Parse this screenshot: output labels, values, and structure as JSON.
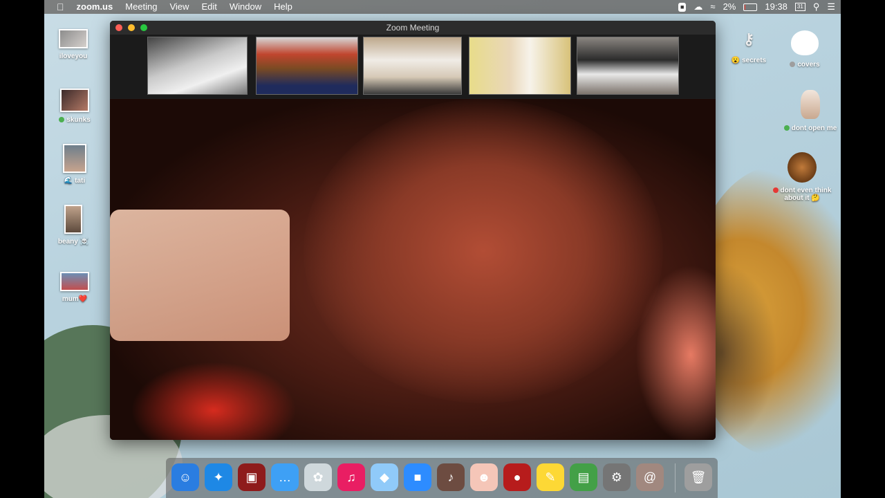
{
  "menubar": {
    "apple_icon": "apple-icon",
    "app_name": "zoom.us",
    "items": [
      "Meeting",
      "View",
      "Edit",
      "Window",
      "Help"
    ],
    "battery_percent": "2%",
    "battery_level": 0.02,
    "clock": "19:38"
  },
  "window": {
    "title": "Zoom Meeting",
    "traffic_colors": [
      "#ff5f57",
      "#febc2e",
      "#28c840"
    ]
  },
  "participants_count_visible": 5,
  "desktop_left": [
    {
      "label": "iloveyou"
    },
    {
      "label": "skunks",
      "tag": "#4caf50"
    },
    {
      "label": "tati",
      "emoji": "🌊"
    },
    {
      "label": "beany",
      "emoji": "☠️"
    },
    {
      "label": "mum",
      "emoji": "❤️"
    }
  ],
  "desktop_right": [
    {
      "label": "secrets",
      "emoji": "😮"
    },
    {
      "label": "covers",
      "tag": "#9e9e9e"
    },
    {
      "label": "dont open me",
      "tag": "#4caf50"
    },
    {
      "label": "dont even think about it",
      "tag": "#e53935",
      "emoji": "🤔"
    }
  ],
  "dock": [
    {
      "name": "finder-icon",
      "glyph": "☺",
      "color": "#2a7de1"
    },
    {
      "name": "safari-icon",
      "glyph": "✦",
      "color": "#1e88e5"
    },
    {
      "name": "photo-booth-icon",
      "glyph": "▣",
      "color": "#8e1b1b"
    },
    {
      "name": "messages-icon",
      "glyph": "…",
      "color": "#3ea0f5"
    },
    {
      "name": "skype-icon",
      "glyph": "✿",
      "color": "#cfd8dc"
    },
    {
      "name": "itunes-icon",
      "glyph": "♫",
      "color": "#e91e63"
    },
    {
      "name": "seal-icon",
      "glyph": "◆",
      "color": "#90caf9"
    },
    {
      "name": "zoom-icon",
      "glyph": "■",
      "color": "#2d8cff"
    },
    {
      "name": "garageband-icon",
      "glyph": "♪",
      "color": "#6d4c41"
    },
    {
      "name": "face-icon",
      "glyph": "☻",
      "color": "#f5c6b8"
    },
    {
      "name": "photo-booth-alt-icon",
      "glyph": "●",
      "color": "#b71c1c"
    },
    {
      "name": "stickies-icon",
      "glyph": "✎",
      "color": "#fdd835"
    },
    {
      "name": "preview-icon",
      "glyph": "▤",
      "color": "#43a047"
    },
    {
      "name": "system-preferences-icon",
      "glyph": "⚙",
      "color": "#757575"
    },
    {
      "name": "contacts-icon",
      "glyph": "@",
      "color": "#a1887f"
    },
    {
      "name": "trash-icon",
      "glyph": "🗑",
      "color": "#9e9e9e"
    }
  ]
}
